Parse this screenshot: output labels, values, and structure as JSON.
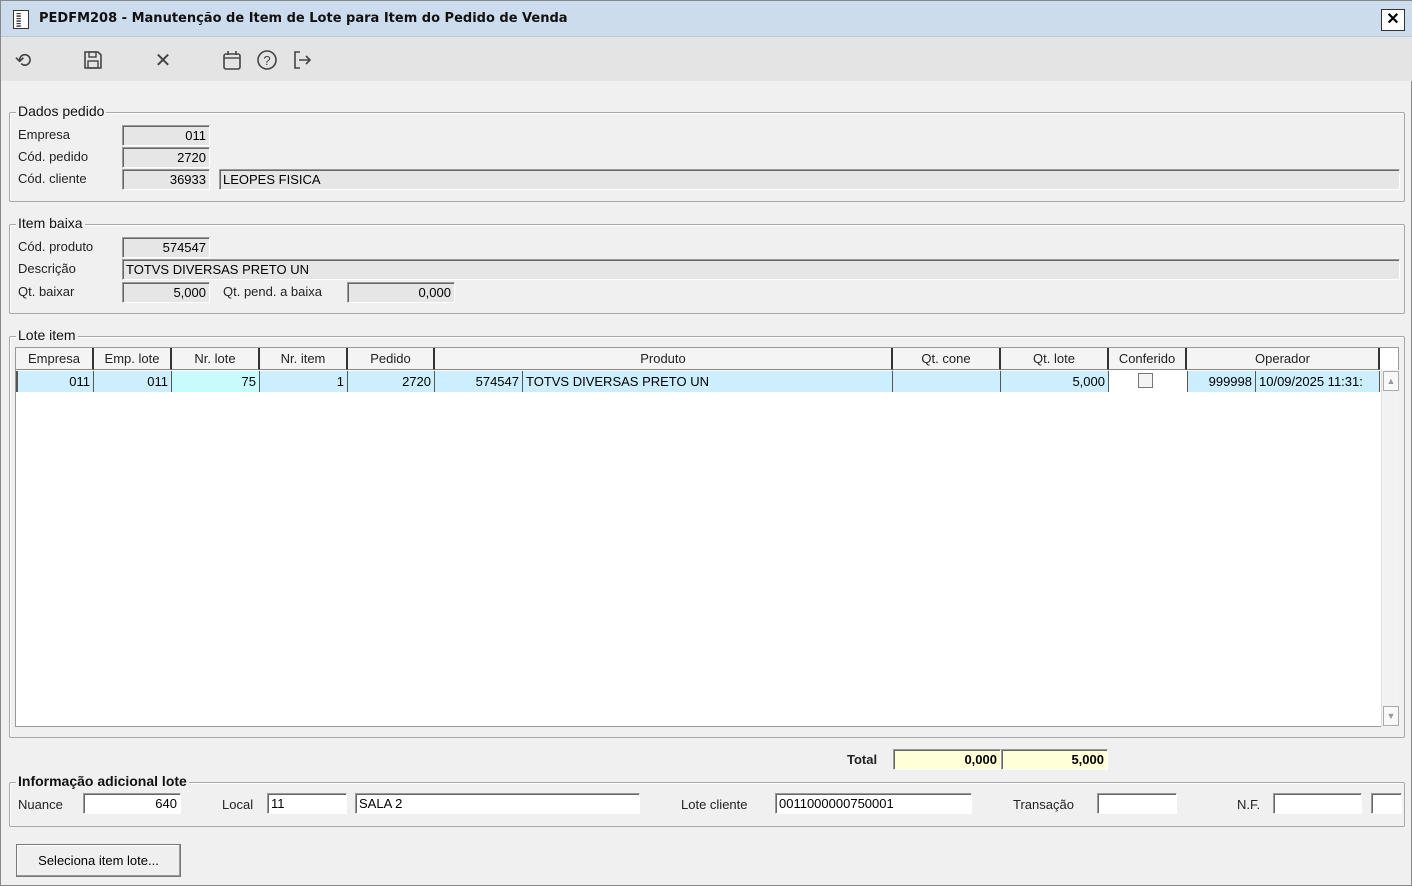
{
  "window": {
    "title": "PEDFM208 - Manutenção de Item de Lote para Item do Pedido de Venda",
    "close": "✕"
  },
  "toolbar": [
    "undo-icon",
    "save-icon",
    "cancel-icon",
    "calendar-icon",
    "help-icon",
    "exit-icon"
  ],
  "dados_pedido": {
    "title": "Dados pedido",
    "empresa_label": "Empresa",
    "empresa": "011",
    "pedido_label": "Cód. pedido",
    "pedido": "2720",
    "cliente_label": "Cód. cliente",
    "cliente": "36933",
    "cliente_nome": "LEOPES FISICA"
  },
  "item_baixa": {
    "title": "Item baixa",
    "produto_label": "Cód. produto",
    "produto": "574547",
    "descricao_label": "Descrição",
    "descricao": "TOTVS DIVERSAS PRETO UN",
    "qt_baixar_label": "Qt. baixar",
    "qt_baixar": "5,000",
    "qt_pend_label": "Qt. pend. a baixa",
    "qt_pend": "0,000"
  },
  "lote_item": {
    "title": "Lote item",
    "columns": [
      "Empresa",
      "Emp. lote",
      "Nr. lote",
      "Nr. item",
      "Pedido",
      "Produto",
      "Qt. cone",
      "Qt. lote",
      "Conferido",
      "Operador"
    ],
    "rows": [
      {
        "empresa": "011",
        "emp_lote": "011",
        "nr_lote": "75",
        "nr_item": "1",
        "pedido": "2720",
        "produto_cod": "574547",
        "produto_desc": "TOTVS DIVERSAS PRETO UN",
        "qt_cone": "",
        "qt_lote": "5,000",
        "conferido": false,
        "operador_cod": "999998",
        "operador_data": "10/09/2025 11:31:"
      }
    ]
  },
  "total": {
    "label": "Total",
    "qt_cone": "0,000",
    "qt_lote": "5,000"
  },
  "info_adicional": {
    "title": "Informação adicional lote",
    "nuance_label": "Nuance",
    "nuance": "640",
    "local_label": "Local",
    "local_cod": "11",
    "local_nome": "SALA 2",
    "lote_cliente_label": "Lote cliente",
    "lote_cliente": "0011000000750001",
    "transacao_label": "Transação",
    "transacao": "",
    "nf_label": "N.F.",
    "nf": "",
    "nf_serie": ""
  },
  "buttons": {
    "seleciona": "Seleciona item lote..."
  }
}
